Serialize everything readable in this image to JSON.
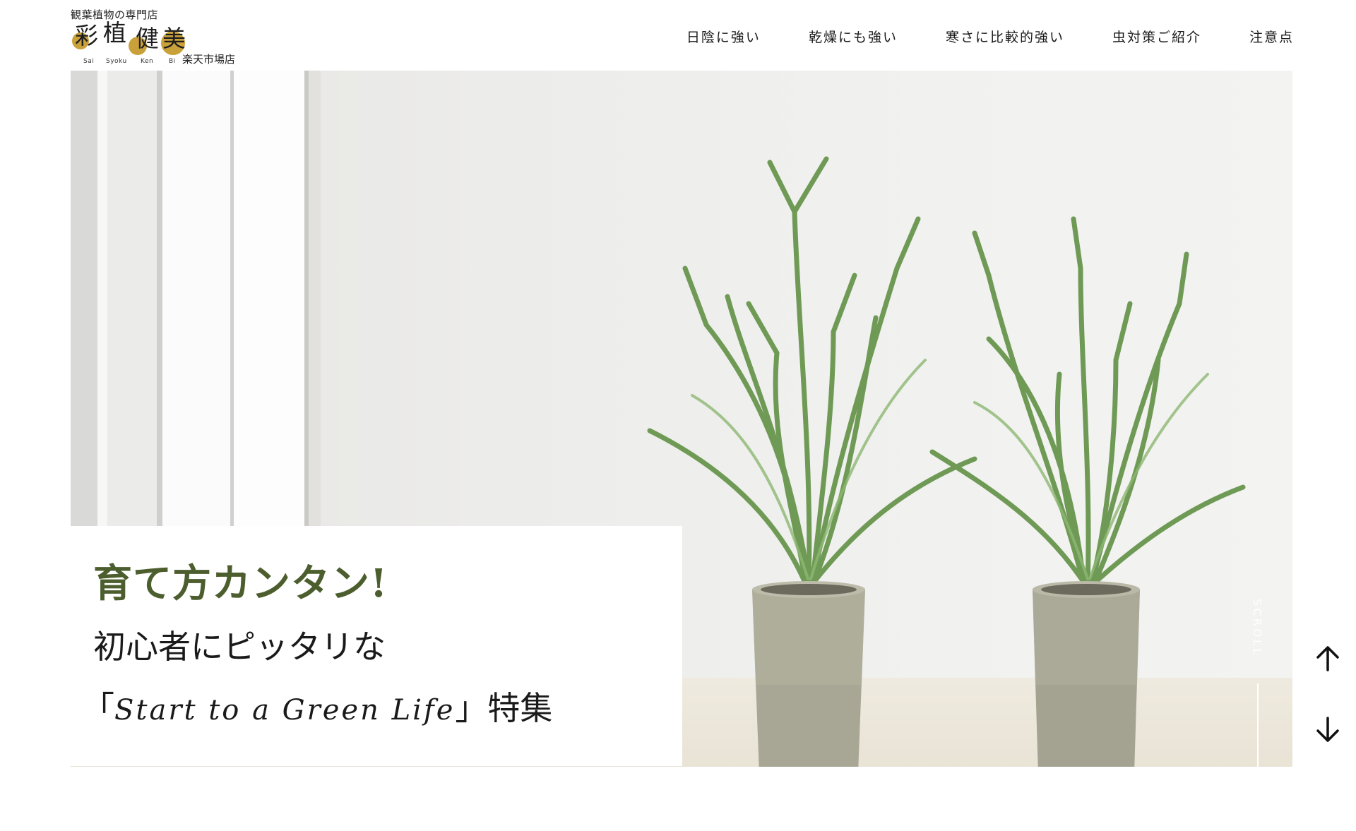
{
  "logo": {
    "tagline": "観葉植物の専門店",
    "kanji": [
      "彩",
      "植",
      "健",
      "美"
    ],
    "romaji": [
      "Sai",
      "Syoku",
      "Ken",
      "Bi"
    ],
    "store": "楽天市場店"
  },
  "nav": {
    "items": [
      {
        "label": "日陰に強い"
      },
      {
        "label": "乾燥にも強い"
      },
      {
        "label": "寒さに比較的強い"
      },
      {
        "label": "虫対策ご紹介"
      },
      {
        "label": "注意点"
      }
    ]
  },
  "hero": {
    "headline": "育て方カンタン!",
    "subheadline": "初心者にピッタリな",
    "feature_open": "「",
    "feature_script": "Start to a Green Life",
    "feature_close": "」特集"
  },
  "scroll": {
    "label": "SCROLL"
  },
  "colors": {
    "accent_green": "#4d5e2e",
    "logo_gold": "#c9a13b"
  },
  "icons": {
    "up": "arrow-up-icon",
    "down": "arrow-down-icon"
  }
}
